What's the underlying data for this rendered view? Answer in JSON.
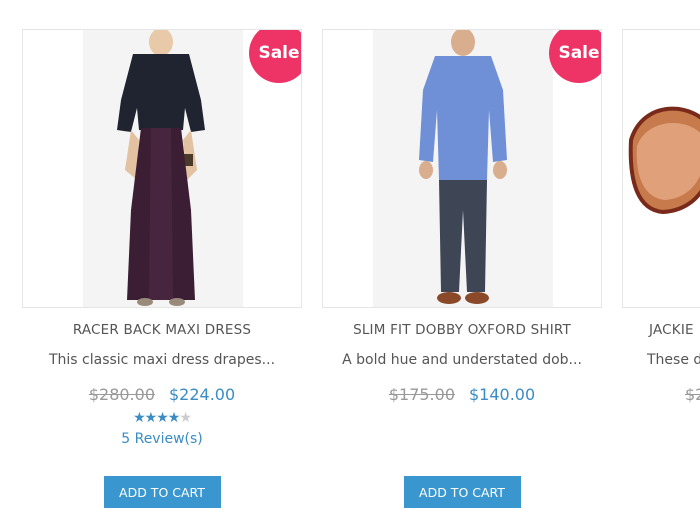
{
  "products": [
    {
      "title": "RACER BACK MAXI DRESS",
      "description": "This classic maxi dress drapes...",
      "old_price": "$280.00",
      "new_price": "$224.00",
      "badge": "Sale",
      "rating": 4,
      "reviews": "5 Review(s)",
      "button": "ADD TO CART"
    },
    {
      "title": "SLIM FIT DOBBY OXFORD SHIRT",
      "description": "A bold hue and understated dob...",
      "old_price": "$175.00",
      "new_price": "$140.00",
      "badge": "Sale",
      "button": "ADD TO CART"
    },
    {
      "title": "JACKIE",
      "description": "These d",
      "old_price": "$2"
    }
  ]
}
